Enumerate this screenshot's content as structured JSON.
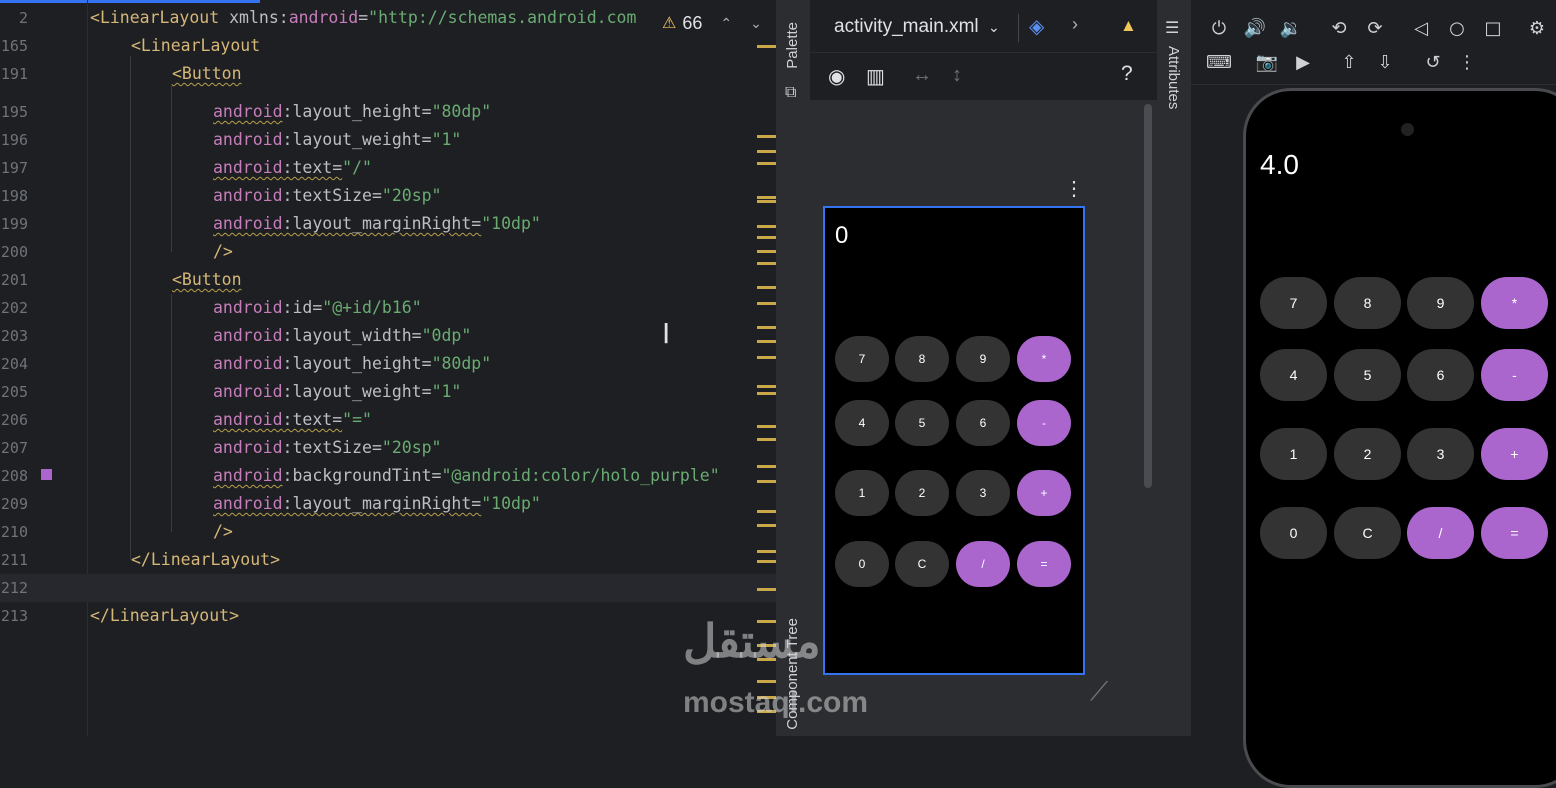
{
  "editor": {
    "inspection_count": "66",
    "lines": [
      {
        "num": "2",
        "code": [
          [
            "<",
            "t-tag"
          ],
          [
            "LinearLayout ",
            "t-tag"
          ],
          [
            "xmlns",
            "t-attr"
          ],
          [
            ":",
            "t-attr"
          ],
          [
            "android",
            "t-ns"
          ],
          [
            "=",
            "t-attr"
          ],
          [
            "\"http://schemas.android.com",
            "t-str"
          ]
        ]
      },
      {
        "num": "165",
        "code": [
          [
            "<LinearLayout",
            "t-tag"
          ]
        ]
      },
      {
        "num": "191",
        "code": [
          [
            "<Button",
            "t-tag sq"
          ]
        ]
      },
      {
        "num": "195",
        "code": [
          [
            "android",
            "t-ns sq"
          ],
          [
            ":layout_height=",
            "t-attr"
          ],
          [
            "\"80dp\"",
            "t-str"
          ]
        ]
      },
      {
        "num": "196",
        "code": [
          [
            "android",
            "t-ns"
          ],
          [
            ":layout_weight=",
            "t-attr"
          ],
          [
            "\"1\"",
            "t-str"
          ]
        ]
      },
      {
        "num": "197",
        "code": [
          [
            "android",
            "t-ns sq"
          ],
          [
            ":text=",
            "t-attr sq"
          ],
          [
            "\"/\"",
            "t-str"
          ]
        ]
      },
      {
        "num": "198",
        "code": [
          [
            "android",
            "t-ns"
          ],
          [
            ":textSize=",
            "t-attr"
          ],
          [
            "\"20sp\"",
            "t-str"
          ]
        ]
      },
      {
        "num": "199",
        "code": [
          [
            "android",
            "t-ns sq"
          ],
          [
            ":layout_marginRight=",
            "t-attr sq"
          ],
          [
            "\"10dp\"",
            "t-str"
          ]
        ]
      },
      {
        "num": "200",
        "code": [
          [
            "/>",
            "t-tag"
          ]
        ]
      },
      {
        "num": "201",
        "code": [
          [
            "<Button",
            "t-tag sq"
          ]
        ]
      },
      {
        "num": "202",
        "code": [
          [
            "android",
            "t-ns"
          ],
          [
            ":id=",
            "t-attr"
          ],
          [
            "\"@+id/b16\"",
            "t-str"
          ]
        ]
      },
      {
        "num": "203",
        "code": [
          [
            "android",
            "t-ns"
          ],
          [
            ":layout_width=",
            "t-attr"
          ],
          [
            "\"0dp\"",
            "t-str"
          ]
        ]
      },
      {
        "num": "204",
        "code": [
          [
            "android",
            "t-ns"
          ],
          [
            ":layout_height=",
            "t-attr"
          ],
          [
            "\"80dp\"",
            "t-str"
          ]
        ]
      },
      {
        "num": "205",
        "code": [
          [
            "android",
            "t-ns"
          ],
          [
            ":layout_weight=",
            "t-attr"
          ],
          [
            "\"1\"",
            "t-str"
          ]
        ]
      },
      {
        "num": "206",
        "code": [
          [
            "android",
            "t-ns sq"
          ],
          [
            ":text=",
            "t-attr sq"
          ],
          [
            "\"=\"",
            "t-str"
          ]
        ]
      },
      {
        "num": "207",
        "code": [
          [
            "android",
            "t-ns"
          ],
          [
            ":textSize=",
            "t-attr"
          ],
          [
            "\"20sp\"",
            "t-str"
          ]
        ]
      },
      {
        "num": "208",
        "code": [
          [
            "android",
            "t-ns sq"
          ],
          [
            ":backgroundTint=",
            "t-attr"
          ],
          [
            "\"@android:color/holo_purple\"",
            "t-str"
          ]
        ]
      },
      {
        "num": "209",
        "code": [
          [
            "android",
            "t-ns sq"
          ],
          [
            ":layout_marginRight=",
            "t-attr sq"
          ],
          [
            "\"10dp\"",
            "t-str"
          ]
        ]
      },
      {
        "num": "210",
        "code": [
          [
            "/>",
            "t-tag"
          ]
        ]
      },
      {
        "num": "211",
        "code": [
          [
            "</LinearLayout>",
            "t-tag"
          ]
        ]
      },
      {
        "num": "212",
        "code": []
      },
      {
        "num": "213",
        "code": [
          [
            "</LinearLayout>",
            "t-tag"
          ]
        ]
      }
    ]
  },
  "side_tabs": {
    "palette": "Palette",
    "component_tree": "Component Tree",
    "attributes": "Attributes"
  },
  "design": {
    "file_name": "activity_main.xml",
    "preview_display": "0"
  },
  "calculator": {
    "rows": [
      [
        {
          "label": "7",
          "purple": false
        },
        {
          "label": "8",
          "purple": false
        },
        {
          "label": "9",
          "purple": false
        },
        {
          "label": "*",
          "purple": true
        }
      ],
      [
        {
          "label": "4",
          "purple": false
        },
        {
          "label": "5",
          "purple": false
        },
        {
          "label": "6",
          "purple": false
        },
        {
          "label": "-",
          "purple": true
        }
      ],
      [
        {
          "label": "1",
          "purple": false
        },
        {
          "label": "2",
          "purple": false
        },
        {
          "label": "3",
          "purple": false
        },
        {
          "label": "+",
          "purple": true
        }
      ],
      [
        {
          "label": "0",
          "purple": false
        },
        {
          "label": "C",
          "purple": false
        },
        {
          "label": "/",
          "purple": true
        },
        {
          "label": "=",
          "purple": true
        }
      ]
    ]
  },
  "emulator": {
    "display": "4.0"
  },
  "watermark": {
    "arabic": "مستقل",
    "latin": "mostaql.com"
  },
  "colors": {
    "accent": "#3574f0",
    "holo_purple": "#aa66cc",
    "button_gray": "#333333"
  }
}
